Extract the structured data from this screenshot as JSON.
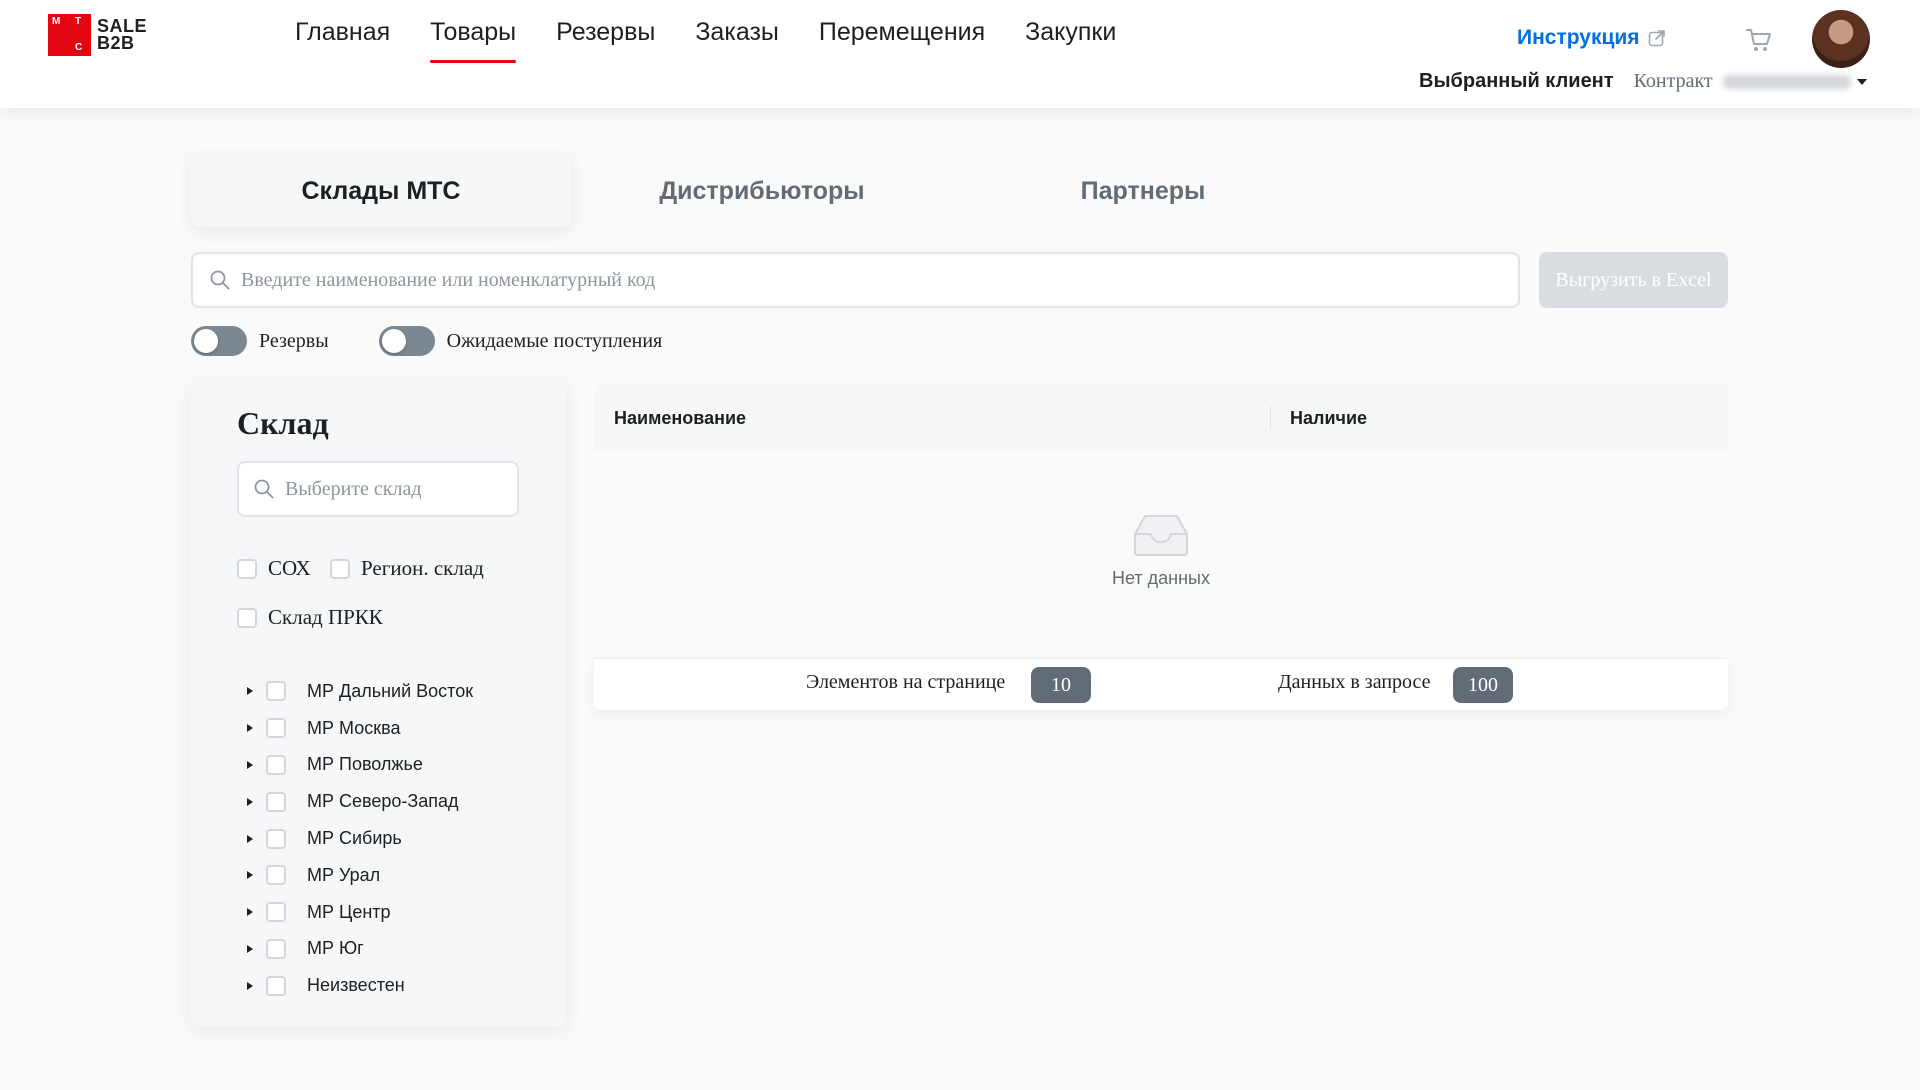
{
  "header": {
    "logo": {
      "mark_letters": [
        "М",
        "Т",
        "С"
      ],
      "text_line1": "SALE",
      "text_line2": "B2B",
      "brand_color": "#e30611"
    },
    "nav": [
      {
        "label": "Главная",
        "active": false
      },
      {
        "label": "Товары",
        "active": true
      },
      {
        "label": "Резервы",
        "active": false
      },
      {
        "label": "Заказы",
        "active": false
      },
      {
        "label": "Перемещения",
        "active": false
      },
      {
        "label": "Закупки",
        "active": false
      }
    ],
    "instruction_link": "Инструкция",
    "selected_client_label": "Выбранный клиент",
    "contract_label": "Контракт",
    "icons": [
      "external-link-icon",
      "cart-icon",
      "avatar"
    ]
  },
  "tabs": [
    {
      "label": "Склады МТС",
      "active": true
    },
    {
      "label": "Дистрибьюторы",
      "active": false
    },
    {
      "label": "Партнеры",
      "active": false
    }
  ],
  "search": {
    "placeholder": "Введите наименование или номенклатурный код",
    "value": ""
  },
  "export_button": "Выгрузить в Excel",
  "toggles": [
    {
      "label": "Резервы",
      "on": false
    },
    {
      "label": "Ожидаемые поступления",
      "on": false
    }
  ],
  "sidebar": {
    "title": "Склад",
    "search_placeholder": "Выберите склад",
    "options": [
      {
        "label": "СОХ",
        "checked": false
      },
      {
        "label": "Регион. склад",
        "checked": false
      },
      {
        "label": "Склад ПРКК",
        "checked": false
      }
    ],
    "regions": [
      "МР Дальний Восток",
      "МР Москва",
      "МР Поволжье",
      "МР Северо-Запад",
      "МР Сибирь",
      "МР Урал",
      "МР Центр",
      "МР Юг",
      "Неизвестен"
    ]
  },
  "table": {
    "columns": [
      "Наименование",
      "Наличие"
    ],
    "empty_text": "Нет данных",
    "pager": {
      "per_page_label": "Элементов на странице",
      "per_page_value": "10",
      "request_label": "Данных в запросе",
      "request_value": "100"
    }
  },
  "colors": {
    "accent_red": "#e30611",
    "link_blue": "#0070e5",
    "text_dark": "#1d2023",
    "text_muted": "#626c77"
  }
}
